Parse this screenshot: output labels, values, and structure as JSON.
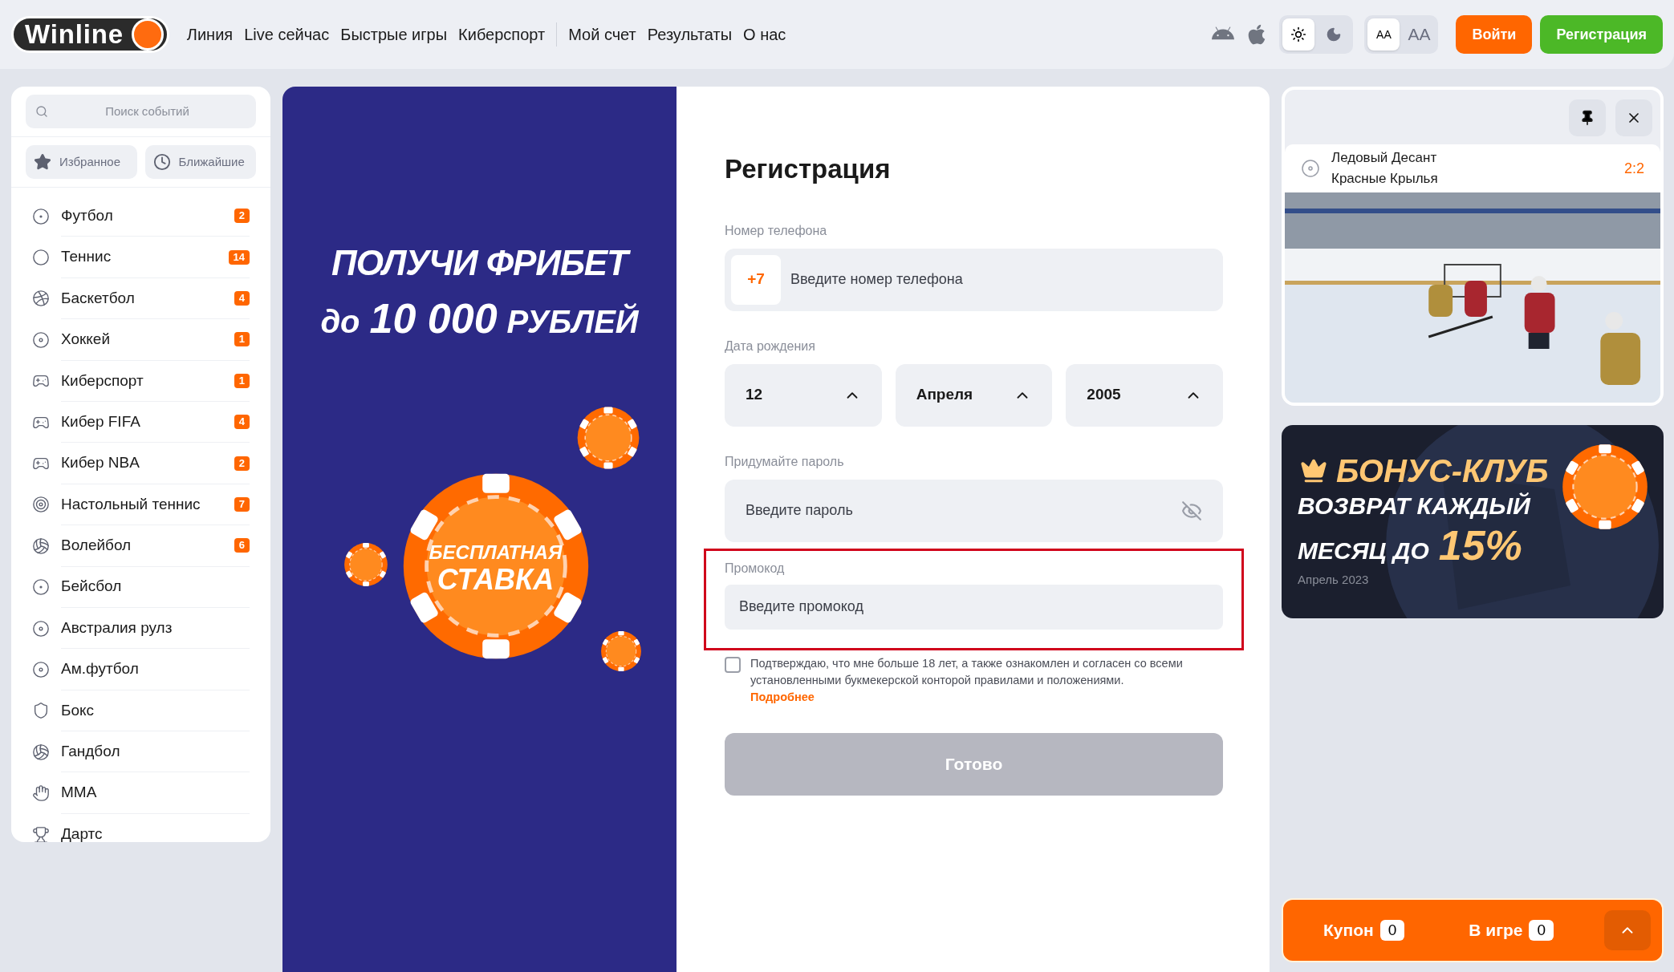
{
  "header": {
    "logo": "Winline",
    "nav": [
      "Линия",
      "Live сейчас",
      "Быстрые игры",
      "Киберспорт"
    ],
    "nav_secondary": [
      "Мой счет",
      "Результаты",
      "О нас"
    ],
    "theme_toggle": [
      {
        "kind": "light",
        "selected": true
      },
      {
        "kind": "dark",
        "selected": false
      }
    ],
    "font_size_toggle": [
      {
        "label": "AA",
        "kind": "small",
        "selected": true
      },
      {
        "label": "AA",
        "kind": "large",
        "selected": false
      }
    ],
    "login_button": "Войти",
    "register_button": "Регистрация"
  },
  "sidebar": {
    "search": {
      "placeholder": "Поиск событий"
    },
    "quick_filters": [
      {
        "kind": "favorites",
        "label": "Избранное"
      },
      {
        "kind": "upcoming",
        "label": "Ближайшие"
      }
    ],
    "sports": [
      {
        "name": "Футбол",
        "count": "2"
      },
      {
        "name": "Теннис",
        "count": "14"
      },
      {
        "name": "Баскетбол",
        "count": "4"
      },
      {
        "name": "Хоккей",
        "count": "1"
      },
      {
        "name": "Киберспорт",
        "count": "1"
      },
      {
        "name": "Кибер FIFA",
        "count": "4"
      },
      {
        "name": "Кибер NBA",
        "count": "2"
      },
      {
        "name": "Настольный теннис",
        "count": "7"
      },
      {
        "name": "Волейбол",
        "count": "6"
      },
      {
        "name": "Бейсбол"
      },
      {
        "name": "Австралия рулз"
      },
      {
        "name": "Ам.футбол"
      },
      {
        "name": "Бокс"
      },
      {
        "name": "Гандбол"
      },
      {
        "name": "MMA"
      },
      {
        "name": "Дартс"
      }
    ]
  },
  "promo_banner": {
    "headline": "ПОЛУЧИ ФРИБЕТ",
    "subline": [
      "до",
      "10 000",
      "РУБЛЕЙ"
    ],
    "chip_text": [
      "БЕСПЛАТНАЯ",
      "СТАВКА"
    ]
  },
  "form": {
    "title": "Регистрация",
    "phone": {
      "label": "Номер телефона",
      "prefix": "+7",
      "placeholder": "Введите номер телефона"
    },
    "birth_date": {
      "label": "Дата рождения",
      "fields": [
        {
          "value": "12"
        },
        {
          "value": "Апреля"
        },
        {
          "value": "2005"
        }
      ]
    },
    "password": {
      "label": "Придумайте пароль",
      "placeholder": "Введите пароль"
    },
    "promo_code": {
      "label": "Промокод",
      "placeholder": "Введите промокод",
      "highlighted": true
    },
    "consent": {
      "checked": false,
      "text": "Подтверждаю, что мне больше 18 лет, а также ознакомлен и согласен со всеми установленными букмекерской конторой правилами и положениями.",
      "link": "Подробнее"
    },
    "submit": {
      "label": "Готово",
      "disabled": true
    }
  },
  "live_widget": {
    "teams": [
      "Ледовый Десант",
      "Красные Крылья"
    ],
    "score": "2:2"
  },
  "bonus_banner": {
    "title": "БОНУС-КЛУБ",
    "lines": [
      "ВОЗВРАТ КАЖДЫЙ",
      "МЕСЯЦ ДО"
    ],
    "percent": "15%",
    "date": "Апрель 2023"
  },
  "coupon_bar": [
    {
      "label": "Купон",
      "count": "0"
    },
    {
      "label": "В игре",
      "count": "0"
    }
  ]
}
